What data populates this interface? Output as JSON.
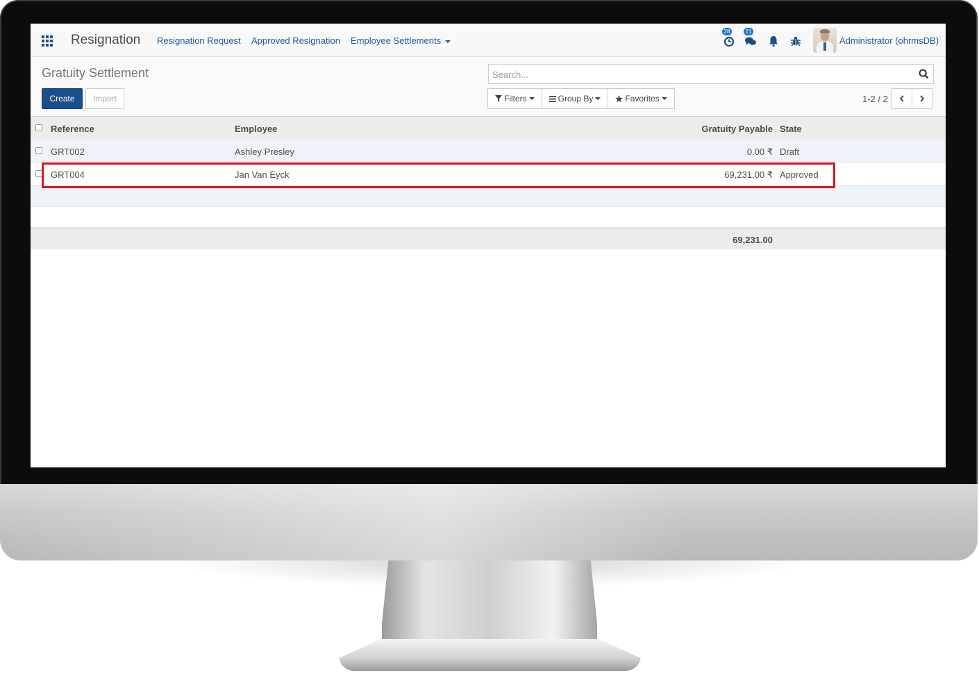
{
  "navbar": {
    "brand": "Resignation",
    "menu": [
      {
        "label": "Resignation Request"
      },
      {
        "label": "Approved Resignation"
      },
      {
        "label": "Employee Settlements"
      }
    ],
    "activity_count": "28",
    "messages_count": "21",
    "user": "Administrator (ohrmsDB)"
  },
  "control": {
    "title": "Gratuity Settlement",
    "create_label": "Create",
    "import_label": "Import",
    "search_placeholder": "Search...",
    "filters_label": "Filters",
    "groupby_label": "Group By",
    "favorites_label": "Favorites",
    "pager": "1-2 / 2"
  },
  "table": {
    "columns": {
      "reference": "Reference",
      "employee": "Employee",
      "gratuity": "Gratuity Payable",
      "state": "State"
    },
    "rows": [
      {
        "reference": "GRT002",
        "employee": "Ashley Presley",
        "gratuity": "0.00 ₹",
        "state": "Draft"
      },
      {
        "reference": "GRT004",
        "employee": "Jan Van Eyck",
        "gratuity": "69,231.00 ₹",
        "state": "Approved"
      }
    ],
    "total": "69,231.00"
  },
  "colors": {
    "primary": "#1b4f8a",
    "link": "#1b5a9e",
    "highlight": "#e0141b",
    "row_alt": "#eef3f9"
  }
}
